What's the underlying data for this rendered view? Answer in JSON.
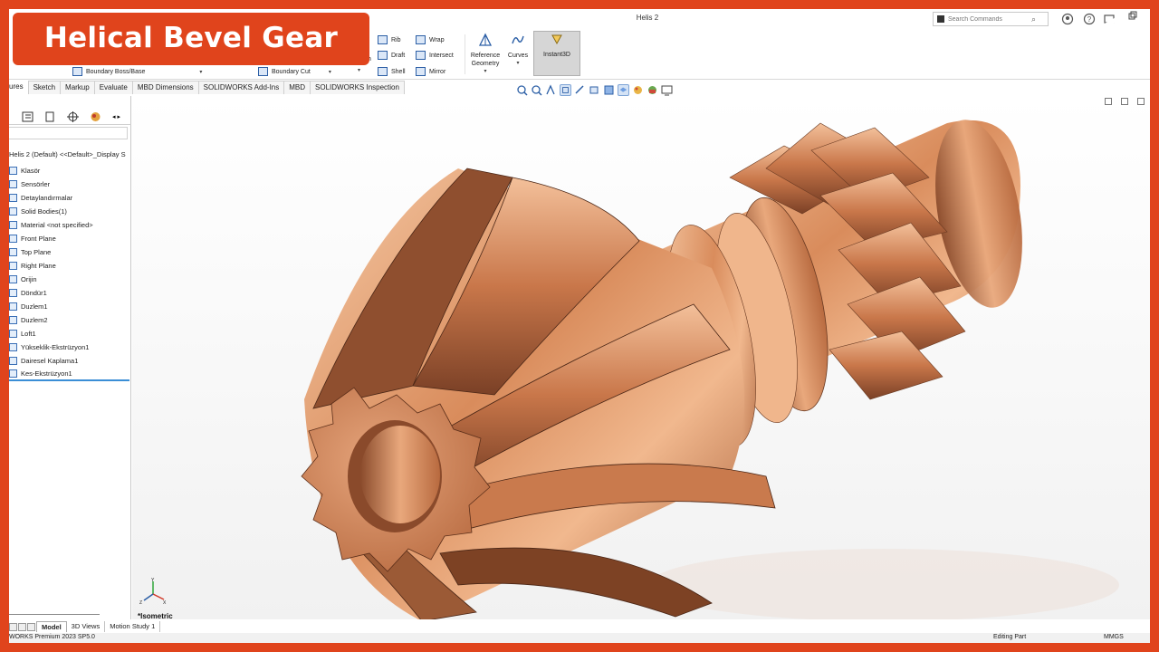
{
  "app": {
    "window_title": "Helis 2"
  },
  "search": {
    "placeholder": "Search Commands"
  },
  "ribbon": {
    "boundary_boss": "Boundary Boss/Base",
    "boundary_cut": "Boundary Cut",
    "rib": "Rib",
    "draft": "Draft",
    "shell": "Shell",
    "wrap": "Wrap",
    "intersect": "Intersect",
    "mirror": "Mirror",
    "reference_geometry_1": "Reference",
    "reference_geometry_2": "Geometry",
    "curves": "Curves",
    "instant3d": "Instant3D"
  },
  "tabs": [
    "ures",
    "Sketch",
    "Markup",
    "Evaluate",
    "MBD Dimensions",
    "SOLIDWORKS Add-Ins",
    "MBD",
    "SOLIDWORKS Inspection"
  ],
  "feature_tree": {
    "root": "Helis 2 (Default) <<Default>_Display S",
    "items": [
      "Klasör",
      "Sensörler",
      "Detaylandırmalar",
      "Solid Bodies(1)",
      "Material <not specified>",
      "Front Plane",
      "Top Plane",
      "Right Plane",
      "Orijin",
      "Döndür1",
      "Duzlem1",
      "Duzlem2",
      "Loft1",
      "Yükseklik-Ekstrüzyon1",
      "Dairesel Kaplama1",
      "Kes-Ekstrüzyon1"
    ]
  },
  "viewport": {
    "view_name": "*Isometric"
  },
  "bottom_tabs": [
    "Model",
    "3D Views",
    "Motion Study 1"
  ],
  "status": {
    "left": "WORKS Premium 2023 SP5.0",
    "editing": "Editing Part",
    "units": "MMGS"
  },
  "overlay": {
    "title": "Helical Bevel Gear"
  },
  "colors": {
    "frame": "#e0441c",
    "copper_light": "#f3c09a",
    "copper_mid": "#d98c5c",
    "copper_dark": "#7a4026",
    "accent_blue": "#3a8ed6"
  }
}
